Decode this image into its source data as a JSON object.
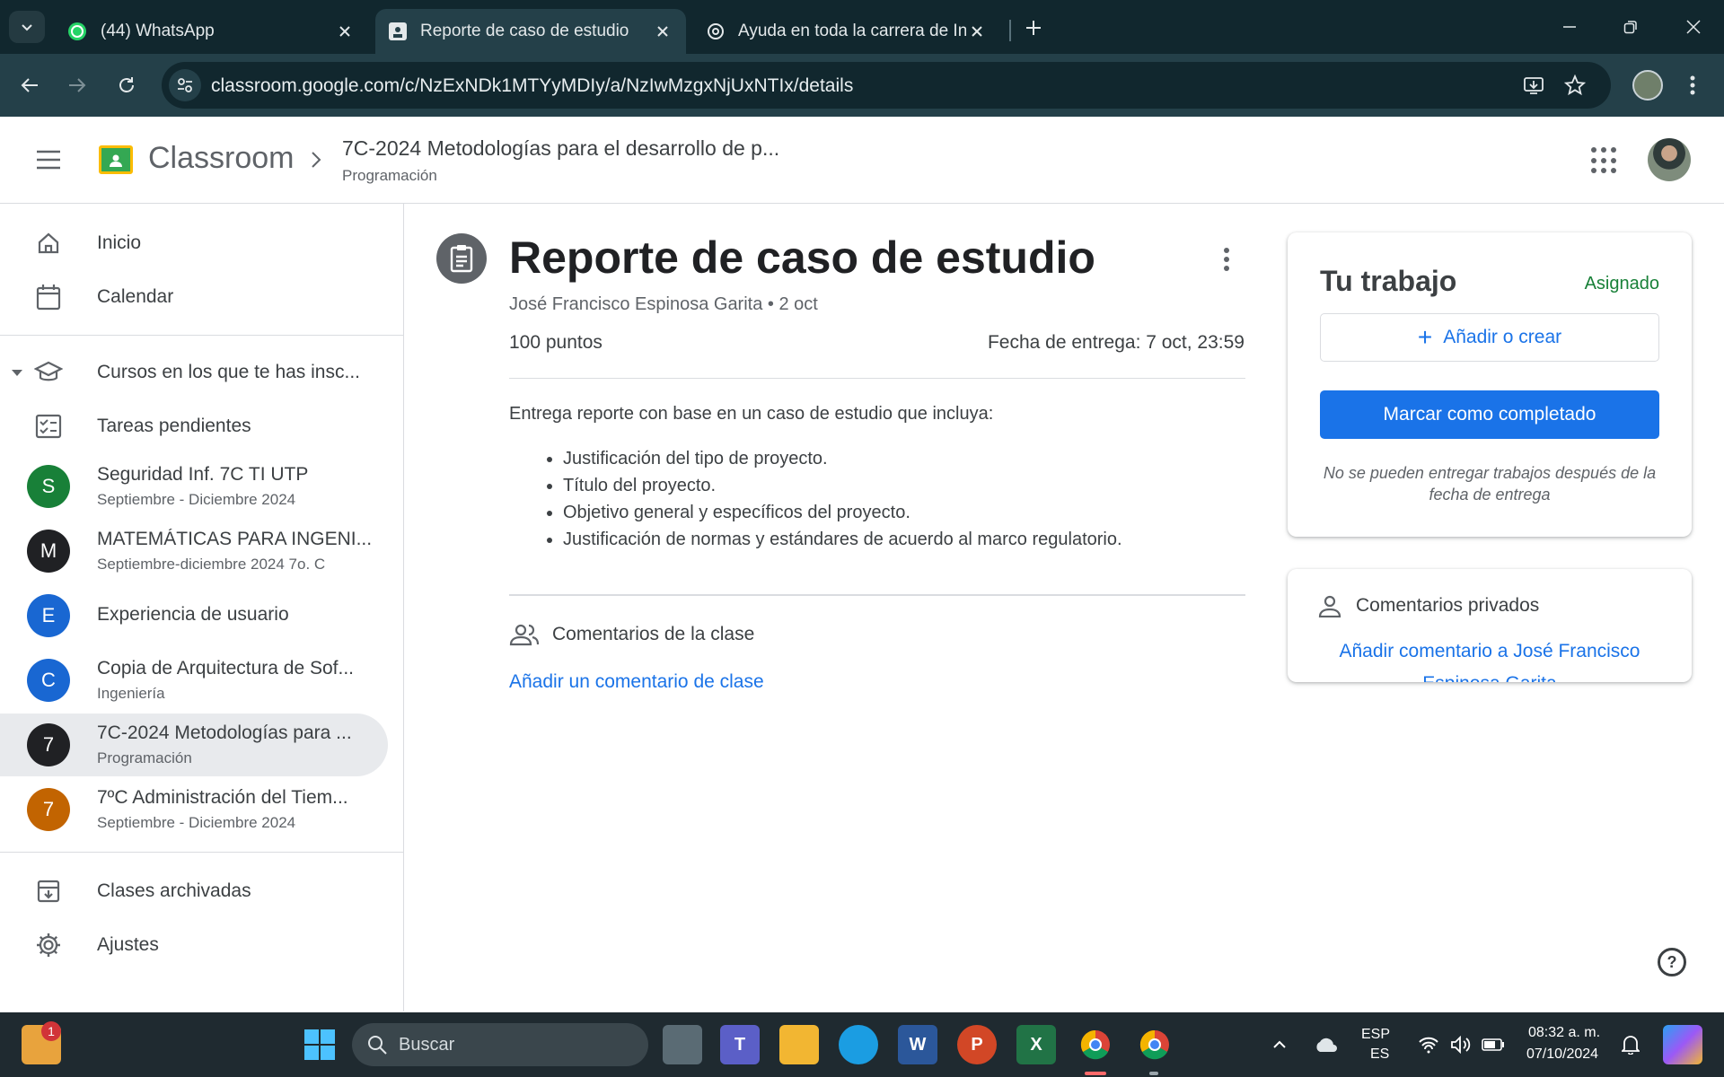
{
  "browser": {
    "tabs": [
      {
        "title": "(44) WhatsApp",
        "icon": "whatsapp-icon"
      },
      {
        "title": "Reporte de caso de estudio",
        "icon": "classroom-icon"
      },
      {
        "title": "Ayuda en toda la carrera de Ing",
        "icon": "chatgpt-icon"
      }
    ],
    "url": "classroom.google.com/c/NzExNDk1MTYyMDIy/a/NzIwMzgxNjUxNTIx/details"
  },
  "header": {
    "app_name": "Classroom",
    "course_title": "7C-2024 Metodologías para el desarrollo de p...",
    "course_subtitle": "Programación"
  },
  "sidebar": {
    "home": "Inicio",
    "calendar": "Calendar",
    "enrolled": "Cursos en los que te has insc...",
    "todo": "Tareas pendientes",
    "courses": [
      {
        "letter": "S",
        "title": "Seguridad Inf. 7C TI UTP",
        "subtitle": "Septiembre - Diciembre 2024",
        "color": "#188038"
      },
      {
        "letter": "M",
        "title": "MATEMÁTICAS PARA INGENI...",
        "subtitle": "Septiembre-diciembre 2024 7o. C",
        "color": "#202124"
      },
      {
        "letter": "E",
        "title": "Experiencia de usuario",
        "subtitle": "",
        "color": "#1967d2"
      },
      {
        "letter": "C",
        "title": "Copia de Arquitectura de Sof...",
        "subtitle": "Ingeniería",
        "color": "#1967d2"
      },
      {
        "letter": "7",
        "title": "7C-2024 Metodologías para ...",
        "subtitle": "Programación",
        "color": "#202124"
      },
      {
        "letter": "7",
        "title": "7ºC Administración del Tiem...",
        "subtitle": "Septiembre - Diciembre 2024",
        "color": "#c26401"
      }
    ],
    "archived": "Clases archivadas",
    "settings": "Ajustes"
  },
  "assignment": {
    "title": "Reporte de caso de estudio",
    "author_date": "José Francisco Espinosa Garita • 2 oct",
    "points": "100 puntos",
    "due": "Fecha de entrega: 7 oct, 23:59",
    "intro": "Entrega reporte con base en un caso de estudio que incluya:",
    "items": [
      "Justificación del tipo de proyecto.",
      "Título del proyecto.",
      "Objetivo general y específicos del proyecto.",
      "Justificación de normas y estándares de acuerdo al marco regulatorio."
    ],
    "class_comments": "Comentarios de la clase",
    "add_class_comment": "Añadir un comentario de clase"
  },
  "work": {
    "title": "Tu trabajo",
    "status": "Asignado",
    "add_create": "Añadir o crear",
    "mark_done": "Marcar como completado",
    "note": "No se pueden entregar trabajos después de la fecha de entrega"
  },
  "private": {
    "title": "Comentarios privados",
    "add": "Añadir comentario a José Francisco Espinosa Garita"
  },
  "taskbar": {
    "search": "Buscar",
    "lang_top": "ESP",
    "lang_bottom": "ES",
    "time": "08:32 a. m.",
    "date": "07/10/2024",
    "notif_count": "1"
  },
  "colors": {
    "accent": "#1a73e8",
    "status_green": "#188038",
    "chrome_dark": "#11272e",
    "chrome_toolbar": "#244049"
  }
}
